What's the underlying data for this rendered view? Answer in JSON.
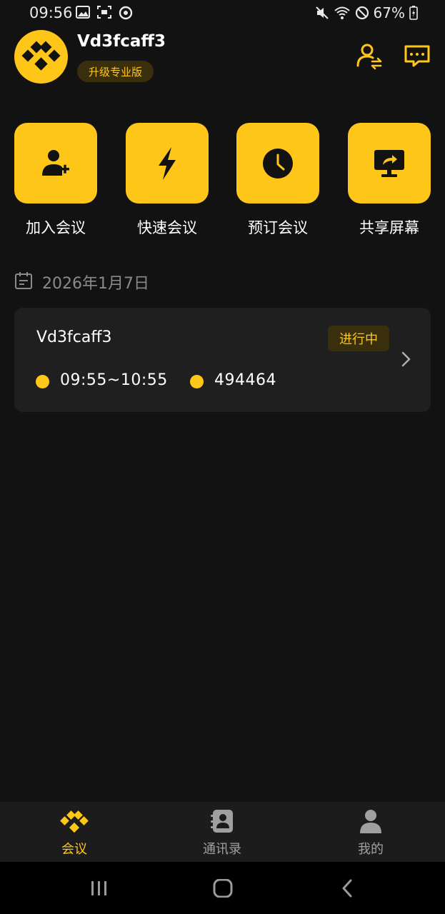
{
  "status_bar": {
    "time": "09:56",
    "battery": "67%",
    "left_icons": [
      "image-icon",
      "screenshot-icon",
      "sync-icon"
    ],
    "right_icons": [
      "mute-icon",
      "wifi-icon",
      "dnd-icon",
      "battery-icon"
    ]
  },
  "header": {
    "user_name": "Vd3fcaff3",
    "upgrade_label": "升级专业版",
    "right_icons": [
      "switch-account-icon",
      "message-icon"
    ]
  },
  "actions": [
    {
      "label": "加入会议",
      "icon": "join-user-icon"
    },
    {
      "label": "快速会议",
      "icon": "lightning-icon"
    },
    {
      "label": "预订会议",
      "icon": "clock-icon"
    },
    {
      "label": "共享屏幕",
      "icon": "share-screen-icon"
    }
  ],
  "date": {
    "icon": "calendar-icon",
    "text": "2026年1月7日"
  },
  "meeting": {
    "title": "Vd3fcaff3",
    "status": "进行中",
    "time_range": "09:55~10:55",
    "meeting_id": "494464"
  },
  "tabs": [
    {
      "label": "会议",
      "icon": "meeting-logo-icon",
      "active": true
    },
    {
      "label": "通讯录",
      "icon": "contacts-icon",
      "active": false
    },
    {
      "label": "我的",
      "icon": "profile-icon",
      "active": false
    }
  ],
  "colors": {
    "accent": "#ffc61a",
    "background": "#121212",
    "card": "#1f1f1f",
    "tab_bar": "#1c1c1c",
    "badge_bg": "#3a2f0d",
    "muted_text": "#8a8a8a"
  }
}
